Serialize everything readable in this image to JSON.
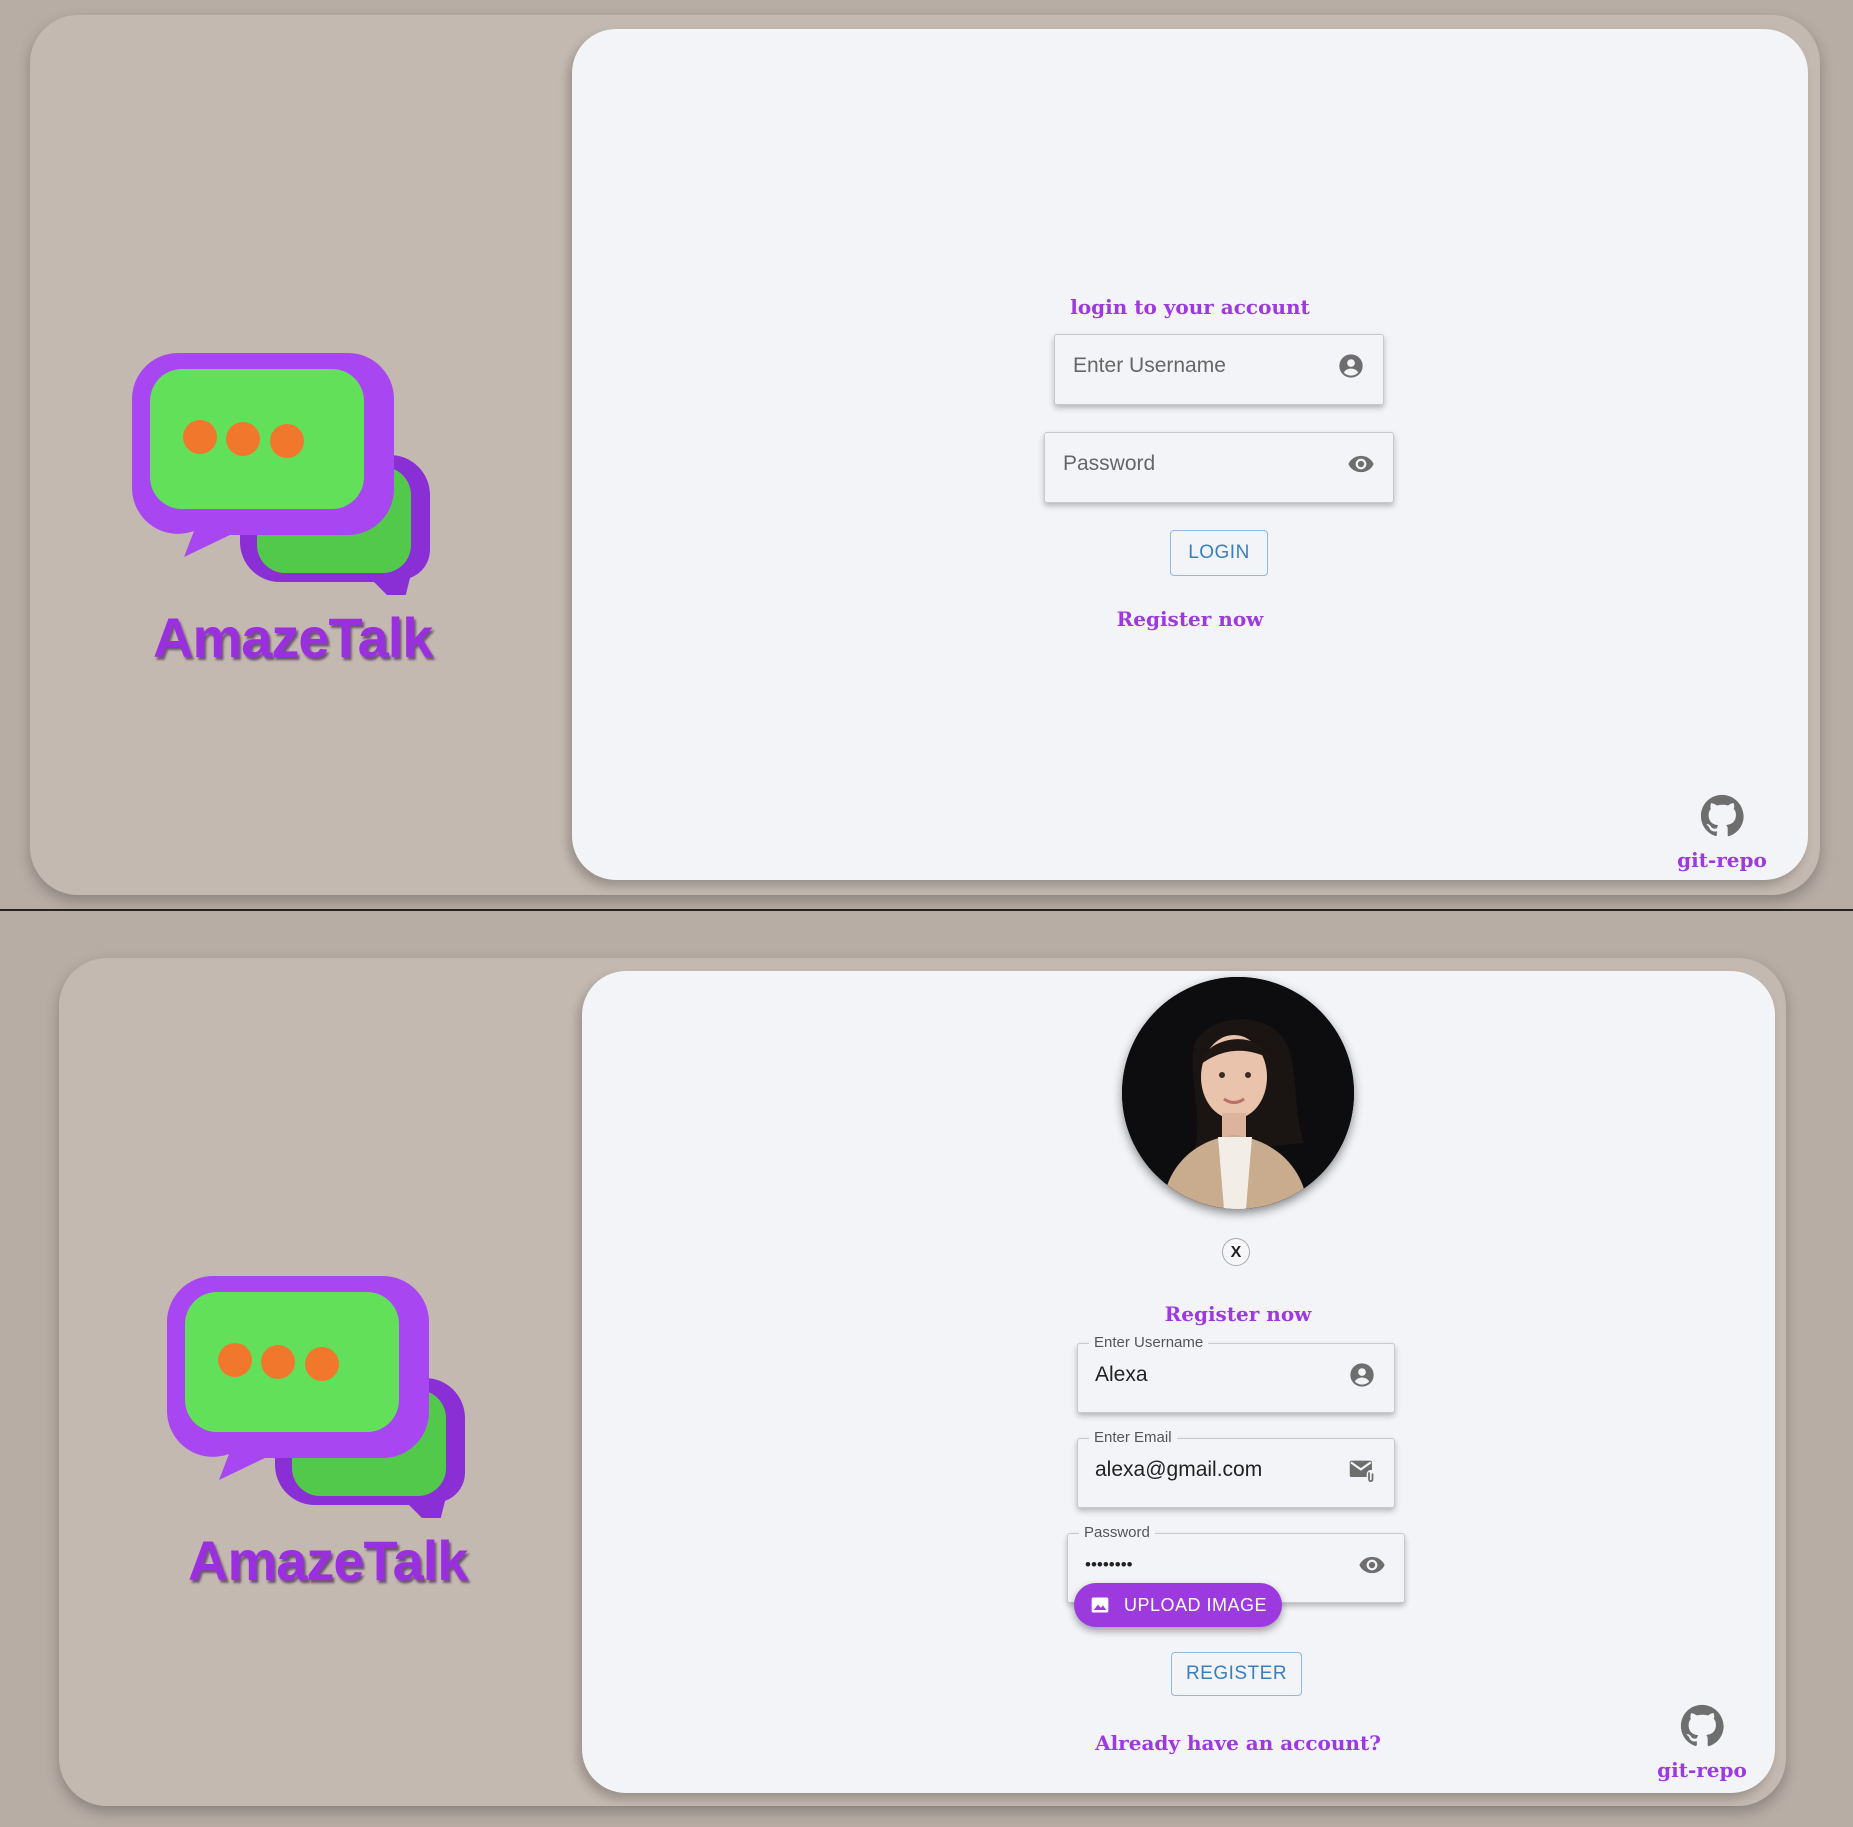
{
  "brand": {
    "name": "AmazeTalk"
  },
  "login": {
    "heading": "login to your account",
    "username_placeholder": "Enter Username",
    "password_placeholder": "Password",
    "login_button": "LOGIN",
    "register_link": "Register now",
    "git_label": "git-repo"
  },
  "register": {
    "close_label": "X",
    "heading": "Register now",
    "username_label": "Enter Username",
    "username_value": "Alexa",
    "email_label": "Enter Email",
    "email_value": "alexa@gmail.com",
    "password_label": "Password",
    "password_value": "••••••••",
    "upload_button": "UPLOAD IMAGE",
    "register_button": "REGISTER",
    "login_link": "Already have an account?",
    "git_label": "git-repo"
  },
  "icons": {
    "user": "account-circle-icon",
    "eye": "eye-icon",
    "mail": "mail-attachment-icon",
    "image": "image-icon",
    "github": "github-icon"
  },
  "colors": {
    "accent": "#9c3ae0",
    "outline_button": "#3a7ec2",
    "card": "#f3f4f8",
    "frame": "#c4b9b0"
  }
}
